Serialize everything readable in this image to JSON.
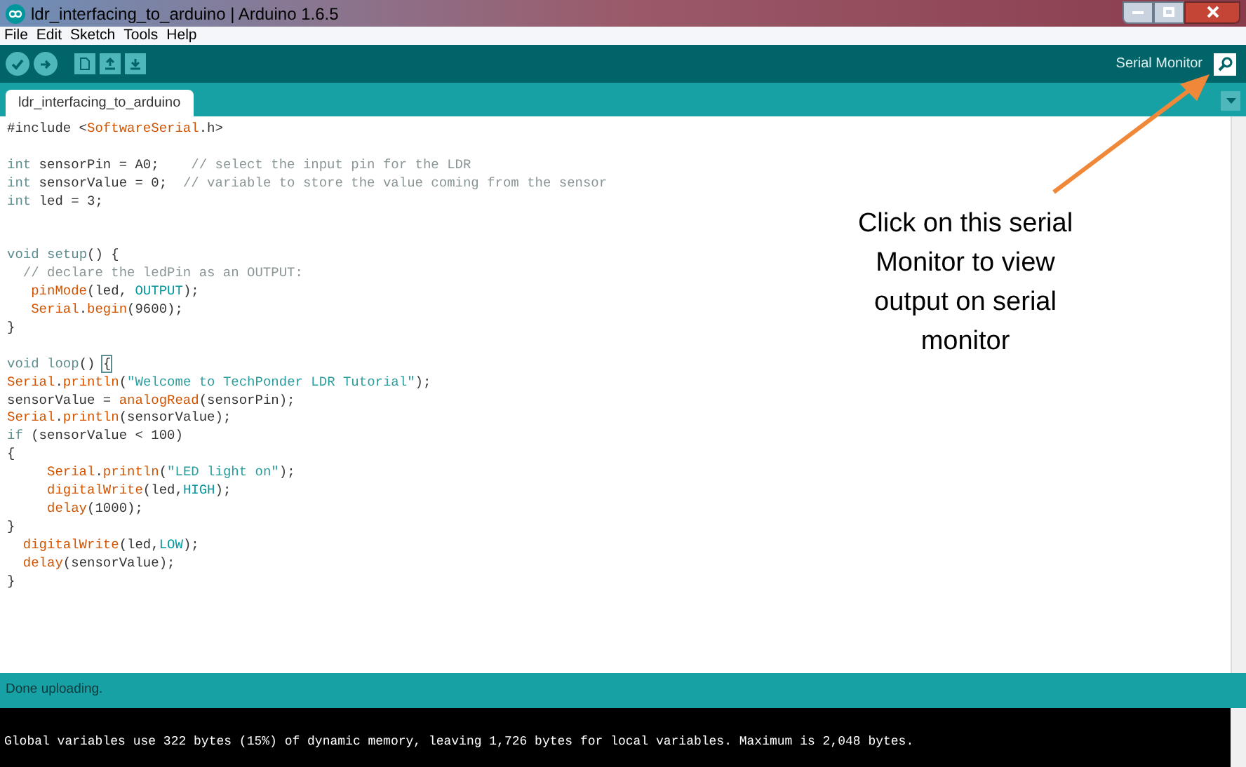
{
  "window": {
    "title": "ldr_interfacing_to_arduino | Arduino 1.6.5"
  },
  "menu": [
    "File",
    "Edit",
    "Sketch",
    "Tools",
    "Help"
  ],
  "toolbar": {
    "serial_monitor_label": "Serial Monitor"
  },
  "tabs": [
    {
      "label": "ldr_interfacing_to_arduino",
      "selected": true
    }
  ],
  "code_lines": [
    {
      "kind": "code",
      "segments": [
        {
          "text": "#include <",
          "kind": "plain"
        },
        {
          "text": "SoftwareSerial",
          "kind": "function"
        },
        {
          "text": ".h>",
          "kind": "plain"
        }
      ]
    },
    {
      "kind": "blank"
    },
    {
      "kind": "code",
      "segments": [
        {
          "text": "int",
          "kind": "keyword"
        },
        {
          "text": " sensorPin = A0;    ",
          "kind": "plain"
        },
        {
          "text": "// select the input pin for the LDR",
          "kind": "comment"
        }
      ]
    },
    {
      "kind": "code",
      "segments": [
        {
          "text": "int",
          "kind": "keyword"
        },
        {
          "text": " sensorValue = 0;  ",
          "kind": "plain"
        },
        {
          "text": "// variable to store the value coming from the sensor",
          "kind": "comment"
        }
      ]
    },
    {
      "kind": "code",
      "segments": [
        {
          "text": "int",
          "kind": "keyword"
        },
        {
          "text": " led = 3;",
          "kind": "plain"
        }
      ]
    },
    {
      "kind": "blank"
    },
    {
      "kind": "blank"
    },
    {
      "kind": "code",
      "segments": [
        {
          "text": "void ",
          "kind": "keyword"
        },
        {
          "text": "setup",
          "kind": "keyword"
        },
        {
          "text": "() {",
          "kind": "plain"
        }
      ]
    },
    {
      "kind": "code",
      "segments": [
        {
          "text": "  // declare the ledPin as an OUTPUT:",
          "kind": "comment"
        }
      ]
    },
    {
      "kind": "code",
      "segments": [
        {
          "text": "   pinMode",
          "kind": "function"
        },
        {
          "text": "(led, ",
          "kind": "plain"
        },
        {
          "text": "OUTPUT",
          "kind": "constant"
        },
        {
          "text": ");",
          "kind": "plain"
        }
      ]
    },
    {
      "kind": "code",
      "segments": [
        {
          "text": "   Serial",
          "kind": "function"
        },
        {
          "text": ".",
          "kind": "plain"
        },
        {
          "text": "begin",
          "kind": "function"
        },
        {
          "text": "(9600);",
          "kind": "plain"
        }
      ]
    },
    {
      "kind": "code",
      "segments": [
        {
          "text": "}",
          "kind": "plain"
        }
      ]
    },
    {
      "kind": "blank"
    },
    {
      "kind": "code",
      "segments": [
        {
          "text": "void ",
          "kind": "keyword"
        },
        {
          "text": "loop",
          "kind": "keyword"
        },
        {
          "text": "() ",
          "kind": "plain"
        },
        {
          "text": "{",
          "kind": "bracket_match"
        }
      ]
    },
    {
      "kind": "code",
      "segments": [
        {
          "text": "Serial",
          "kind": "function"
        },
        {
          "text": ".",
          "kind": "plain"
        },
        {
          "text": "println",
          "kind": "function"
        },
        {
          "text": "(",
          "kind": "plain"
        },
        {
          "text": "\"Welcome to TechPonder LDR Tutorial\"",
          "kind": "string"
        },
        {
          "text": ");",
          "kind": "plain"
        }
      ]
    },
    {
      "kind": "code",
      "segments": [
        {
          "text": "sensorValue = ",
          "kind": "plain"
        },
        {
          "text": "analogRead",
          "kind": "function"
        },
        {
          "text": "(sensorPin);",
          "kind": "plain"
        }
      ]
    },
    {
      "kind": "code",
      "segments": [
        {
          "text": "Serial",
          "kind": "function"
        },
        {
          "text": ".",
          "kind": "plain"
        },
        {
          "text": "println",
          "kind": "function"
        },
        {
          "text": "(sensorValue);",
          "kind": "plain"
        }
      ]
    },
    {
      "kind": "code",
      "segments": [
        {
          "text": "if",
          "kind": "keyword"
        },
        {
          "text": " (sensorValue < 100)",
          "kind": "plain"
        }
      ]
    },
    {
      "kind": "code",
      "segments": [
        {
          "text": "{",
          "kind": "plain"
        }
      ]
    },
    {
      "kind": "code",
      "segments": [
        {
          "text": "     Serial",
          "kind": "function"
        },
        {
          "text": ".",
          "kind": "plain"
        },
        {
          "text": "println",
          "kind": "function"
        },
        {
          "text": "(",
          "kind": "plain"
        },
        {
          "text": "\"LED light on\"",
          "kind": "string"
        },
        {
          "text": ");",
          "kind": "plain"
        }
      ]
    },
    {
      "kind": "code",
      "segments": [
        {
          "text": "     digitalWrite",
          "kind": "function"
        },
        {
          "text": "(led,",
          "kind": "plain"
        },
        {
          "text": "HIGH",
          "kind": "constant"
        },
        {
          "text": ");",
          "kind": "plain"
        }
      ]
    },
    {
      "kind": "code",
      "segments": [
        {
          "text": "     delay",
          "kind": "function"
        },
        {
          "text": "(1000);",
          "kind": "plain"
        }
      ]
    },
    {
      "kind": "code",
      "segments": [
        {
          "text": "}",
          "kind": "plain"
        }
      ]
    },
    {
      "kind": "code",
      "segments": [
        {
          "text": "  digitalWrite",
          "kind": "function"
        },
        {
          "text": "(led,",
          "kind": "plain"
        },
        {
          "text": "LOW",
          "kind": "constant"
        },
        {
          "text": ");",
          "kind": "plain"
        }
      ]
    },
    {
      "kind": "code",
      "segments": [
        {
          "text": "  delay",
          "kind": "function"
        },
        {
          "text": "(sensorValue);",
          "kind": "plain"
        }
      ]
    },
    {
      "kind": "code",
      "segments": [
        {
          "text": "}",
          "kind": "plain"
        }
      ]
    }
  ],
  "annotation": {
    "text": "Click on this serial Monitor to view output on serial monitor"
  },
  "status_bar": {
    "text": "Done uploading."
  },
  "console": [
    "Global variables use 322 bytes (15%) of dynamic memory, leaving 1,726 bytes for local variables. Maximum is 2,048 bytes."
  ]
}
